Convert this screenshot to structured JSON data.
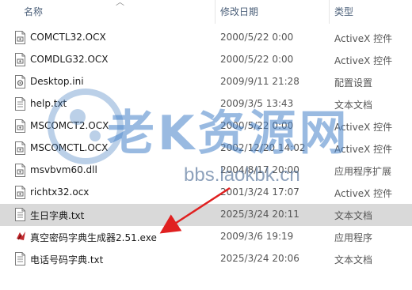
{
  "header": {
    "col_name": "名称",
    "col_date": "修改日期",
    "col_type": "类型"
  },
  "files": [
    {
      "name": "COMCTL32.OCX",
      "date": "2000/5/22 0:00",
      "type": "ActiveX 控件",
      "icon": "ocx-file-icon"
    },
    {
      "name": "COMDLG32.OCX",
      "date": "2000/5/22 0:00",
      "type": "ActiveX 控件",
      "icon": "ocx-file-icon"
    },
    {
      "name": "Desktop.ini",
      "date": "2009/9/11 21:28",
      "type": "配置设置",
      "icon": "settings-file-icon"
    },
    {
      "name": "help.txt",
      "date": "2009/3/5 13:43",
      "type": "文本文档",
      "icon": "text-file-icon"
    },
    {
      "name": "MSCOMCT2.OCX",
      "date": "2000/5/22 0:00",
      "type": "ActiveX 控件",
      "icon": "ocx-file-icon"
    },
    {
      "name": "MSCOMCTL.OCX",
      "date": "2002/12/20 14:02",
      "type": "ActiveX 控件",
      "icon": "ocx-file-icon"
    },
    {
      "name": "msvbvm60.dll",
      "date": "2004/8/17 20:00",
      "type": "应用程序扩展",
      "icon": "dll-file-icon"
    },
    {
      "name": "richtx32.ocx",
      "date": "2001/3/24 17:07",
      "type": "ActiveX 控件",
      "icon": "ocx-file-icon"
    },
    {
      "name": "生日字典.txt",
      "date": "2025/3/24 20:11",
      "type": "文本文档",
      "icon": "text-file-icon",
      "selected": true
    },
    {
      "name": "真空密码字典生成器2.51.exe",
      "date": "2009/3/6 19:19",
      "type": "应用程序",
      "icon": "exe-app-icon"
    },
    {
      "name": "电话号码字典.txt",
      "date": "2025/3/24 20:06",
      "type": "文本文档",
      "icon": "text-file-icon"
    }
  ],
  "watermark": {
    "logo_text": "老K资源网",
    "url": "bbs.laokbk.cn"
  },
  "colors": {
    "selected_row": "#d9d9d9",
    "header_text": "#4c607a",
    "arrow": "#e02020"
  }
}
